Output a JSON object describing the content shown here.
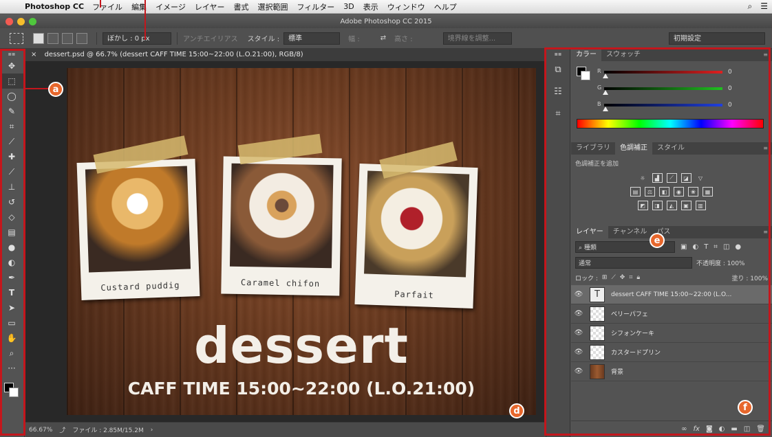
{
  "menubar": {
    "app": "Photoshop CC",
    "items": [
      "ファイル",
      "編集",
      "イメージ",
      "レイヤー",
      "書式",
      "選択範囲",
      "フィルター",
      "3D",
      "表示",
      "ウィンドウ",
      "ヘルプ"
    ]
  },
  "titlebar": {
    "title": "Adobe Photoshop CC 2015"
  },
  "options": {
    "feather_label": "ぼかし : 0 px",
    "antialias": "アンチエイリアス",
    "style_label": "スタイル :",
    "style_value": "標準",
    "width_label": "幅 :",
    "height_label": "高さ :",
    "refine_edge": "境界線を調整...",
    "workspace": "初期設定"
  },
  "document": {
    "tab": "dessert.psd @ 66.7% (dessert CAFF TIME 15:00~22:00 (L.O.21:00), RGB/8)",
    "title": "dessert",
    "subtitle": "CAFF TIME 15:00~22:00 (L.O.21:00)",
    "polaroids": [
      {
        "caption": "Custard puddig"
      },
      {
        "caption": "Caramel chifon"
      },
      {
        "caption": "Parfait"
      }
    ]
  },
  "status": {
    "zoom": "66.67%",
    "file": "ファイル : 2.85M/15.2M"
  },
  "color_panel": {
    "tabs": [
      "カラー",
      "スウォッチ"
    ],
    "channels": [
      {
        "label": "R",
        "value": "0",
        "color": "#e02020"
      },
      {
        "label": "G",
        "value": "0",
        "color": "#20c020"
      },
      {
        "label": "B",
        "value": "0",
        "color": "#2040e0"
      }
    ]
  },
  "adjust_panel": {
    "tabs": [
      "ライブラリ",
      "色調補正",
      "スタイル"
    ],
    "add_label": "色調補正を追加"
  },
  "layers_panel": {
    "tabs": [
      "レイヤー",
      "チャンネル",
      "パス"
    ],
    "filter_kind": "種類",
    "blend_mode": "通常",
    "opacity_label": "不透明度 : 100%",
    "lock_label": "ロック :",
    "fill_label": "塗り : 100%",
    "layers": [
      {
        "name": "dessert CAFF TIME 15:00~22:00 (L.O...",
        "type": "text"
      },
      {
        "name": "ベリーパフェ",
        "type": "image"
      },
      {
        "name": "シフォンケーキ",
        "type": "image"
      },
      {
        "name": "カスタードプリン",
        "type": "image"
      },
      {
        "name": "背景",
        "type": "background"
      }
    ]
  },
  "callouts": {
    "a": "a",
    "d": "d",
    "e": "e",
    "f": "f"
  },
  "colors": {
    "annotation_red": "#c4161c",
    "callout_orange": "#e7672c"
  }
}
